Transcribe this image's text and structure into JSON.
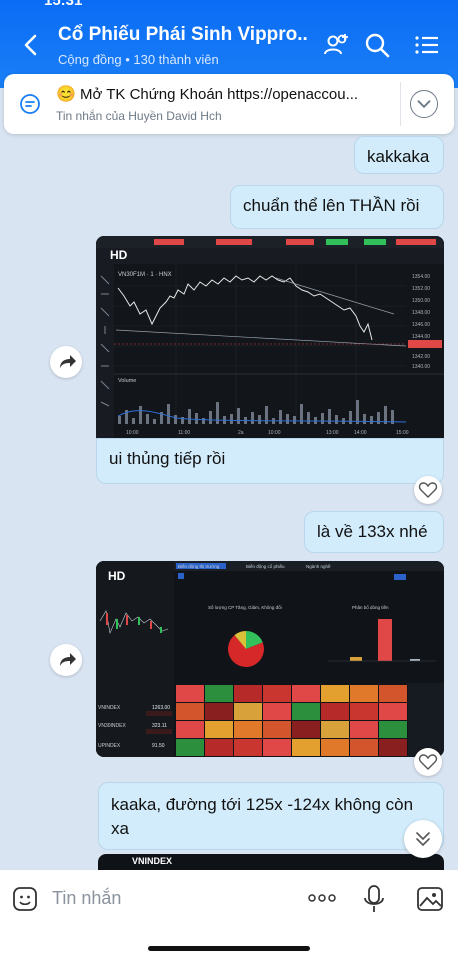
{
  "header": {
    "status_time": "15:31",
    "title": "Cổ Phiếu Phái Sinh Vippro...",
    "subtitle": "Cộng đồng • 130 thành viên",
    "icons": [
      "back-icon",
      "group-add-icon",
      "search-icon",
      "menu-icon"
    ]
  },
  "pinned": {
    "emoji": "😊",
    "text": "Mở TK Chứng Khoán https://openaccou...",
    "sub": "Tin nhắn của Huyền David Hch"
  },
  "messages": {
    "m1": "kakkaka",
    "m2": "chuẩn thể lên THẦN rồi",
    "m3": "ui thủng tiếp rồi",
    "m4": "là về 133x nhé",
    "m5": "kaaka, đường tới 125x -124x không còn xa"
  },
  "image1": {
    "hd": "HD",
    "symbol": "VN30F1M · 1 · HNX",
    "vol_label": "Volume",
    "price_labels": [
      "1354.00",
      "1352.00",
      "1350.00",
      "1348.00",
      "1346.00",
      "1344.00",
      "1342.00",
      "1340.00"
    ],
    "time_labels": [
      "10:00",
      "11:00",
      "2a",
      "10:00",
      "13:00",
      "14:00",
      "15:00"
    ]
  },
  "image2": {
    "hd": "HD",
    "tabs": [
      "Biến động thị trường",
      "Biến động cổ phiếu",
      "Ngành nghề"
    ],
    "pie_title": "Số lượng CP Tăng, Giảm, Không đổi",
    "bar_title": "Phân bổ dòng tiền",
    "indices": [
      {
        "name": "VNINDEX",
        "value": "1263.00"
      },
      {
        "name": "VN30INDEX",
        "value": "323.11"
      },
      {
        "name": "UPINDEX",
        "value": "91.50"
      }
    ],
    "pie": {
      "tang": 19,
      "giam": 70,
      "khong_doi": 11
    }
  },
  "image3": {
    "label": "VNINDEX"
  },
  "input": {
    "placeholder": "Tin nhắn"
  },
  "colors": {
    "header": "#0a6cf5",
    "bubble": "#d2ecfb",
    "background": "#d9e4f2"
  }
}
